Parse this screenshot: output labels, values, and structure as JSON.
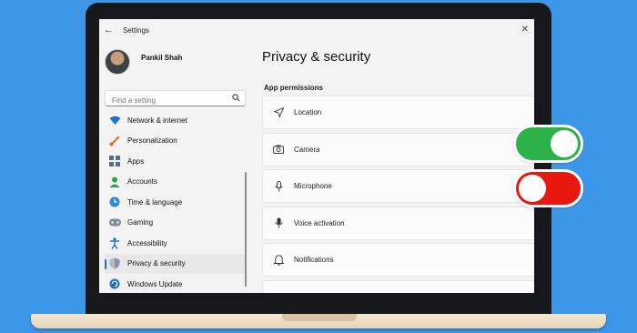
{
  "window": {
    "title": "Settings"
  },
  "profile": {
    "name": "Pankil Shah"
  },
  "search": {
    "placeholder": "Find a setting"
  },
  "sidebar": {
    "items": [
      {
        "label": "Network & internet",
        "icon": "wifi-icon"
      },
      {
        "label": "Personalization",
        "icon": "brush-icon"
      },
      {
        "label": "Apps",
        "icon": "apps-icon"
      },
      {
        "label": "Accounts",
        "icon": "person-icon"
      },
      {
        "label": "Time & language",
        "icon": "globe-clock-icon"
      },
      {
        "label": "Gaming",
        "icon": "gamepad-icon"
      },
      {
        "label": "Accessibility",
        "icon": "accessibility-icon"
      },
      {
        "label": "Privacy & security",
        "icon": "shield-icon",
        "active": true
      },
      {
        "label": "Windows Update",
        "icon": "update-icon"
      }
    ]
  },
  "main": {
    "title": "Privacy & security",
    "section": "App permissions",
    "rows": [
      {
        "label": "Location",
        "icon": "location-arrow-icon"
      },
      {
        "label": "Camera",
        "icon": "camera-icon"
      },
      {
        "label": "Microphone",
        "icon": "microphone-icon"
      },
      {
        "label": "Voice activation",
        "icon": "voice-icon"
      },
      {
        "label": "Notifications",
        "icon": "bell-icon"
      }
    ]
  },
  "toggles": [
    {
      "state": "on",
      "color": "#2bb34a"
    },
    {
      "state": "off",
      "color": "#e8180f"
    }
  ],
  "colors": {
    "background": "#3d97e8",
    "accent": "#1f6fd1"
  }
}
